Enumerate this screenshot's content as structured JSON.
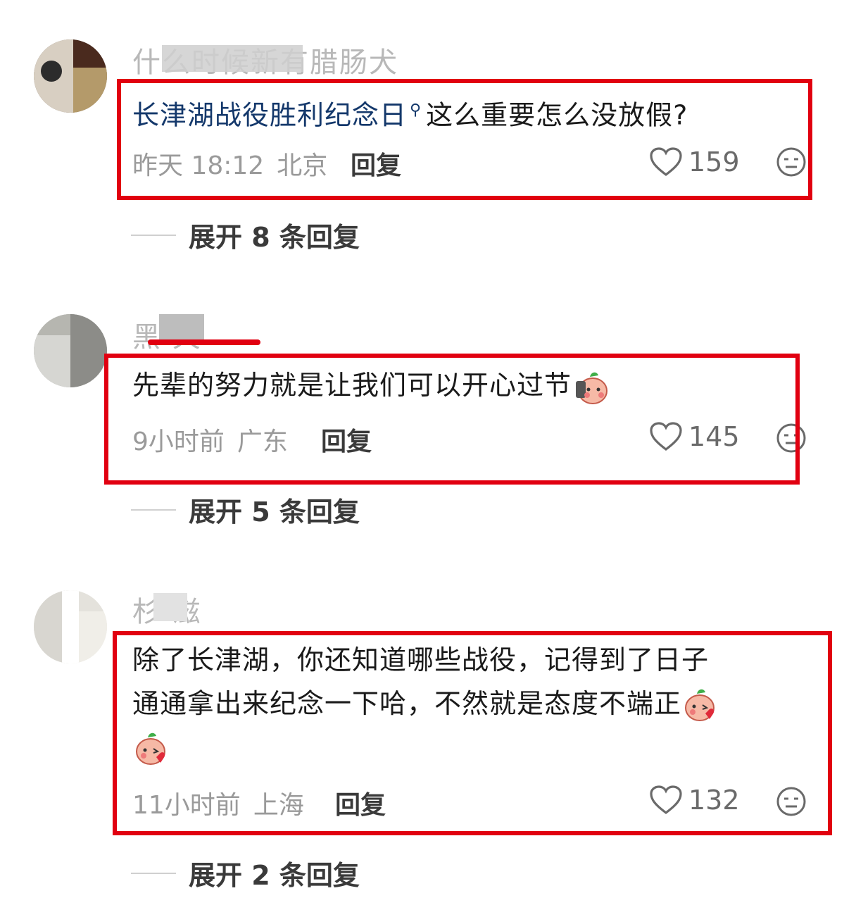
{
  "comments": [
    {
      "username": "什么时候新有腊肠犬",
      "text_link": "长津湖战役胜利纪念日",
      "text_rest": "这么重要怎么没放假?",
      "time": "昨天 18:12",
      "location": "北京",
      "reply_label": "回复",
      "likes": "159",
      "expand_label": "展开 8 条回复"
    },
    {
      "username": "黑 天",
      "text": "先辈的努力就是让我们可以开心过节",
      "time": "9小时前",
      "location": "广东",
      "reply_label": "回复",
      "likes": "145",
      "expand_label": "展开 5 条回复"
    },
    {
      "username": "杉 滋",
      "text_line1": "除了长津湖，你还知道哪些战役，记得到了日子",
      "text_line2": "通通拿出来纪念一下哈，不然就是态度不端正",
      "time": "11小时前",
      "location": "上海",
      "reply_label": "回复",
      "likes": "132",
      "expand_label": "展开 2 条回复"
    }
  ],
  "icons": {
    "like": "heart-outline-icon",
    "more": "neutral-face-icon",
    "emoji": "peach-kiss-emoji"
  },
  "colors": {
    "highlight_box": "#e10010",
    "link_text": "#14386b"
  }
}
